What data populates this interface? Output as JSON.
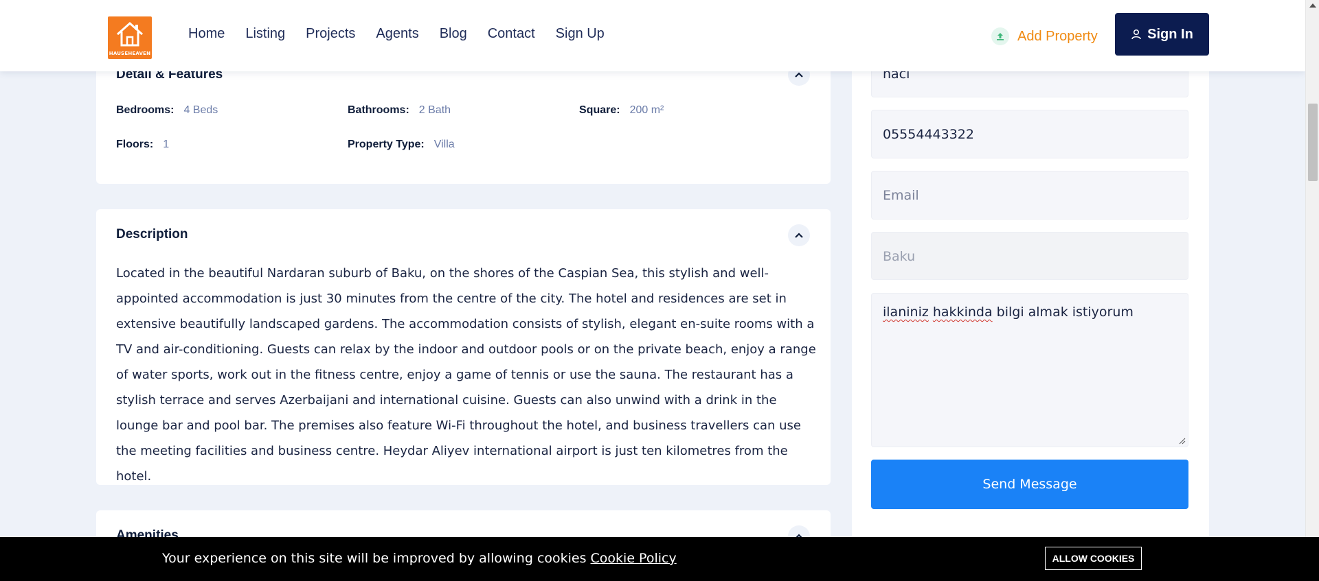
{
  "header": {
    "logo_text": "HAUSEHEAVEN",
    "nav": [
      "Home",
      "Listing",
      "Projects",
      "Agents",
      "Blog",
      "Contact",
      "Sign Up"
    ],
    "add_property": "Add Property",
    "sign_in": "Sign In"
  },
  "details": {
    "title": "Detail & Features",
    "features": [
      {
        "label": "Bedrooms:",
        "value": "4 Beds"
      },
      {
        "label": "Bathrooms:",
        "value": "2 Bath"
      },
      {
        "label": "Square:",
        "value": "200 m²"
      },
      {
        "label": "Floors:",
        "value": "1"
      },
      {
        "label": "Property Type:",
        "value": "Villa"
      }
    ]
  },
  "description": {
    "title": "Description",
    "text": "Located in the beautiful Nardaran suburb of Baku, on the shores of the Caspian Sea, this stylish and well-appointed accommodation is just 30 minutes from the centre of the city. The hotel and residences are set in extensive beautifully landscaped gardens. The accommodation consists of stylish, elegant en-suite rooms with a TV and air-conditioning. Guests can relax by the indoor and outdoor pools or on the private beach, enjoy a range of water sports, work out in the fitness centre, enjoy a game of tennis or use the sauna. The restaurant has a stylish terrace and serves Azerbaijani and international cuisine. Guests can also unwind with a drink in the lounge bar and pool bar. The premises also feature Wi-Fi throughout the hotel, and business travellers can use the meeting facilities and business centre. Heydar Aliyev international airport is just ten kilometres from the hotel."
  },
  "amenities": {
    "title": "Amenities"
  },
  "contact_form": {
    "name_value": "naci",
    "phone_value": "05554443322",
    "email_placeholder": "Email",
    "city_value": "Baku",
    "message_words": [
      "ilaniniz",
      "hakkinda",
      "bilgi almak istiyorum"
    ],
    "send_label": "Send Message"
  },
  "cookie": {
    "message": "Your experience on this site will be improved by allowing cookies",
    "policy_link": "Cookie Policy",
    "allow_label": "ALLOW COOKIES"
  },
  "colors": {
    "accent_orange": "#f08a12",
    "navy": "#0c1c50",
    "blue_button": "#1a82f7"
  }
}
